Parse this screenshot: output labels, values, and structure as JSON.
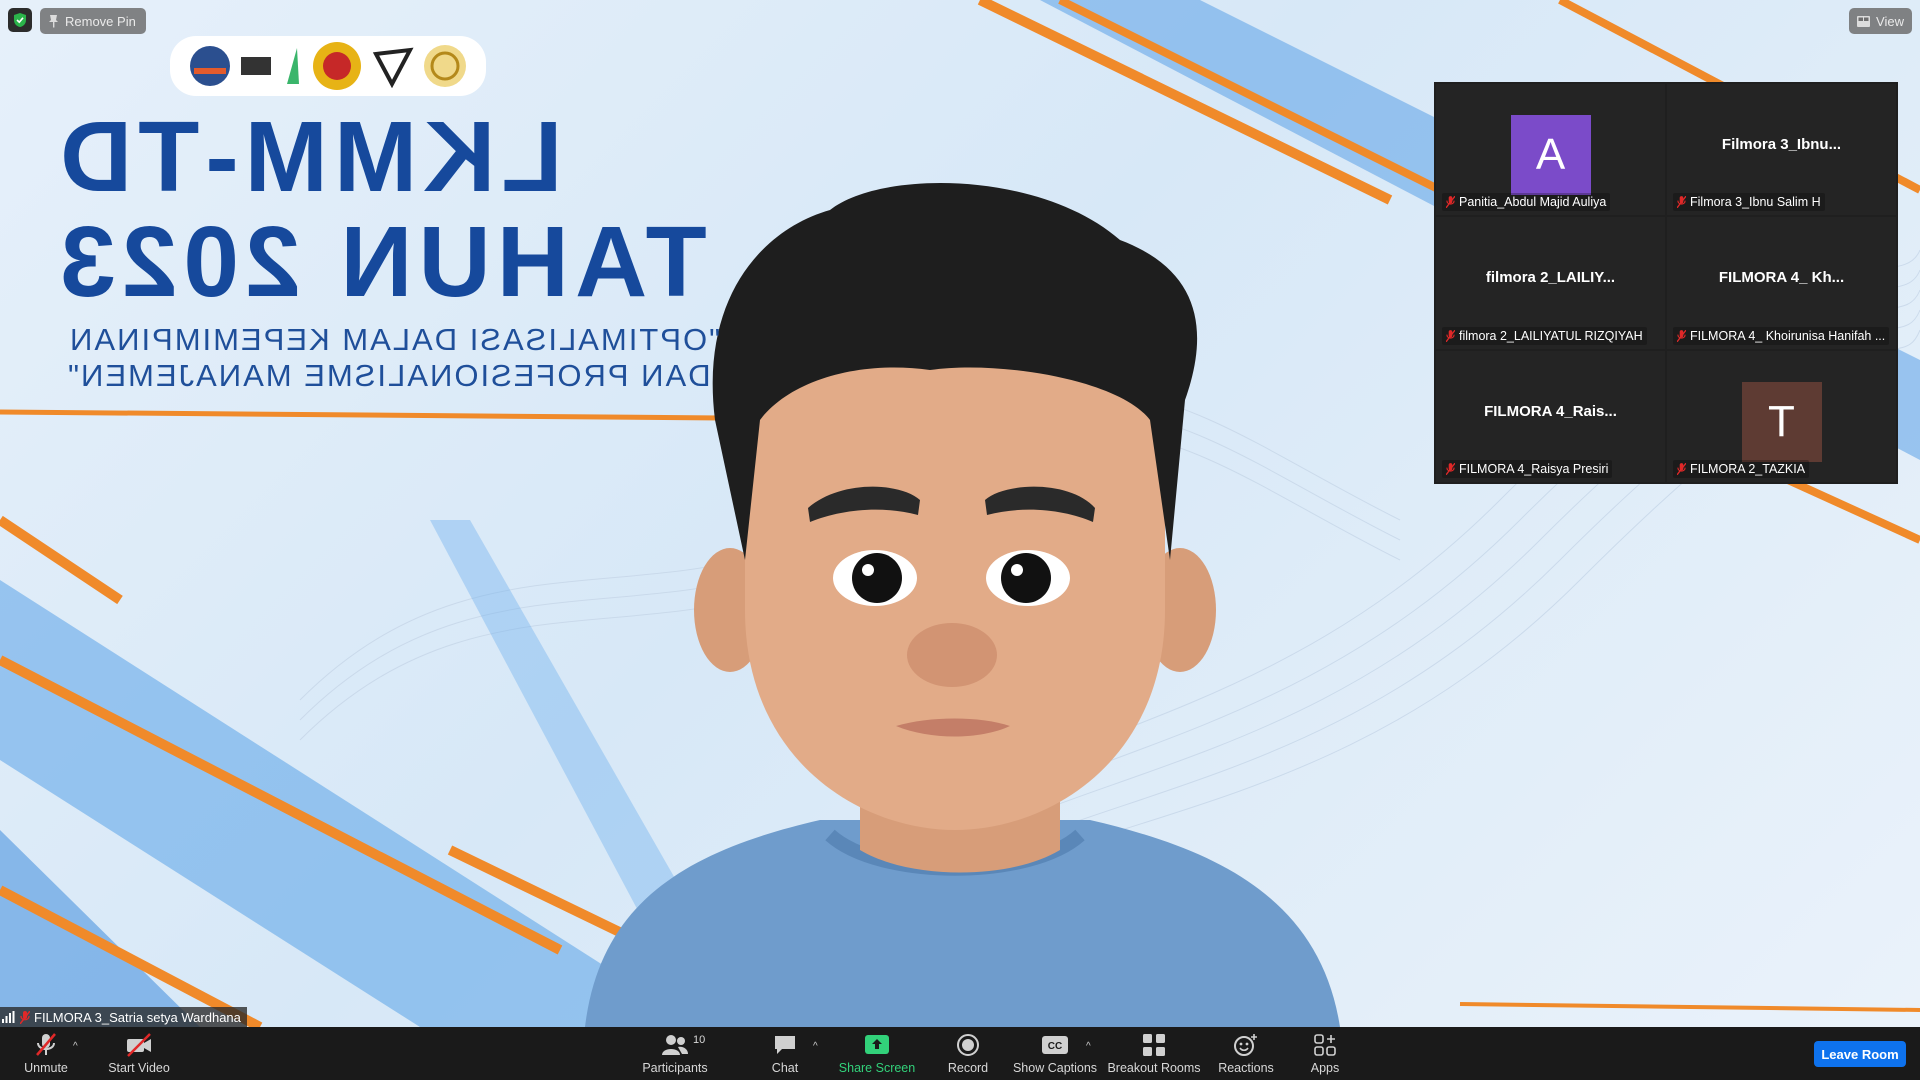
{
  "top_bar": {
    "remove_pin_label": "Remove Pin",
    "view_label": "View"
  },
  "banner": {
    "line1": "LKMM-TD",
    "line2": "TAHUN 2023",
    "sub1": "\"OPTIMALISASI DALAM KEPEMIMPINAN",
    "sub2": "DAN PROFESIONALISME MANAJEMEN\""
  },
  "gallery": {
    "tiles": [
      {
        "avatar_letter": "A",
        "avatar_color": "#7b4bc9",
        "center_name": "",
        "label": "Panitia_Abdul Majid Auliya"
      },
      {
        "avatar_letter": "",
        "avatar_color": "",
        "center_name": "Filmora 3_Ibnu...",
        "label": "Filmora 3_Ibnu Salim H"
      },
      {
        "avatar_letter": "",
        "avatar_color": "",
        "center_name": "filmora 2_LAILIY...",
        "label": "filmora 2_LAILIYATUL RIZQIYAH"
      },
      {
        "avatar_letter": "",
        "avatar_color": "",
        "center_name": "FILMORA 4_ Kh...",
        "label": "FILMORA 4_ Khoirunisa Hanifah ..."
      },
      {
        "avatar_letter": "",
        "avatar_color": "",
        "center_name": "FILMORA 4_Rais...",
        "label": "FILMORA 4_Raisya Presiri"
      },
      {
        "avatar_letter": "T",
        "avatar_color": "#5e3b33",
        "center_name": "",
        "label": "FILMORA 2_TAZKIA"
      }
    ]
  },
  "speaker": {
    "name": "FILMORA 3_Satria setya Wardhana"
  },
  "toolbar": {
    "unmute": "Unmute",
    "start_video": "Start Video",
    "participants": "Participants",
    "participants_count": "10",
    "chat": "Chat",
    "share_screen": "Share Screen",
    "record": "Record",
    "show_captions": "Show Captions",
    "breakout_rooms": "Breakout Rooms",
    "reactions": "Reactions",
    "apps": "Apps",
    "leave_room": "Leave Room"
  },
  "colors": {
    "share_green": "#32d17a",
    "leave_blue": "#0e72ed",
    "muted_red": "#e02828"
  }
}
